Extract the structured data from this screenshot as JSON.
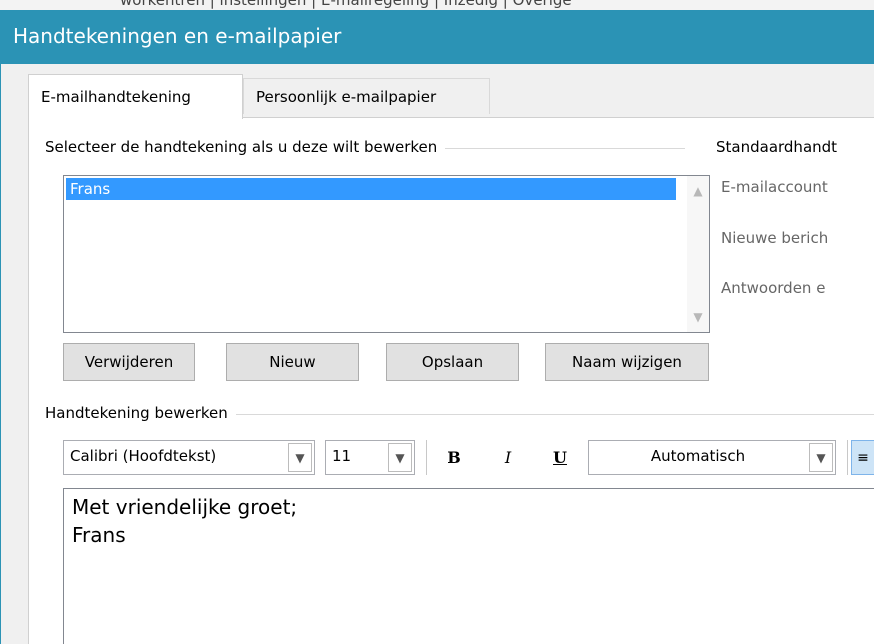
{
  "window": {
    "title": "Handtekeningen en e-mailpapier",
    "background_strip_text": "workentren  |  instellingen  |  E-mailregeling  |  Inzedig  |  Overige"
  },
  "tabs": [
    {
      "label": "E-mailhandtekening",
      "active": true
    },
    {
      "label": "Persoonlijk e-mailpapier",
      "active": false
    }
  ],
  "select_group": {
    "label": "Selecteer de handtekening als u deze wilt bewerken",
    "items": [
      "Frans"
    ],
    "selected": "Frans"
  },
  "buttons": {
    "delete": "Verwijderen",
    "new": "Nieuw",
    "save": "Opslaan",
    "rename": "Naam wijzigen"
  },
  "defaults_group": {
    "label": "Standaardhandt",
    "account_label": "E-mailaccount",
    "new_messages_label": "Nieuwe berich",
    "replies_label": "Antwoorden e"
  },
  "edit_group": {
    "label": "Handtekening bewerken",
    "font": "Calibri (Hoofdtekst)",
    "size": "11",
    "bold": "B",
    "italic": "I",
    "underline": "U",
    "color": "Automatisch",
    "signature_lines": [
      "Met vriendelijke groet;",
      "Frans"
    ]
  },
  "colors": {
    "titlebar": "#2b93b5",
    "selection": "#3399ff"
  }
}
